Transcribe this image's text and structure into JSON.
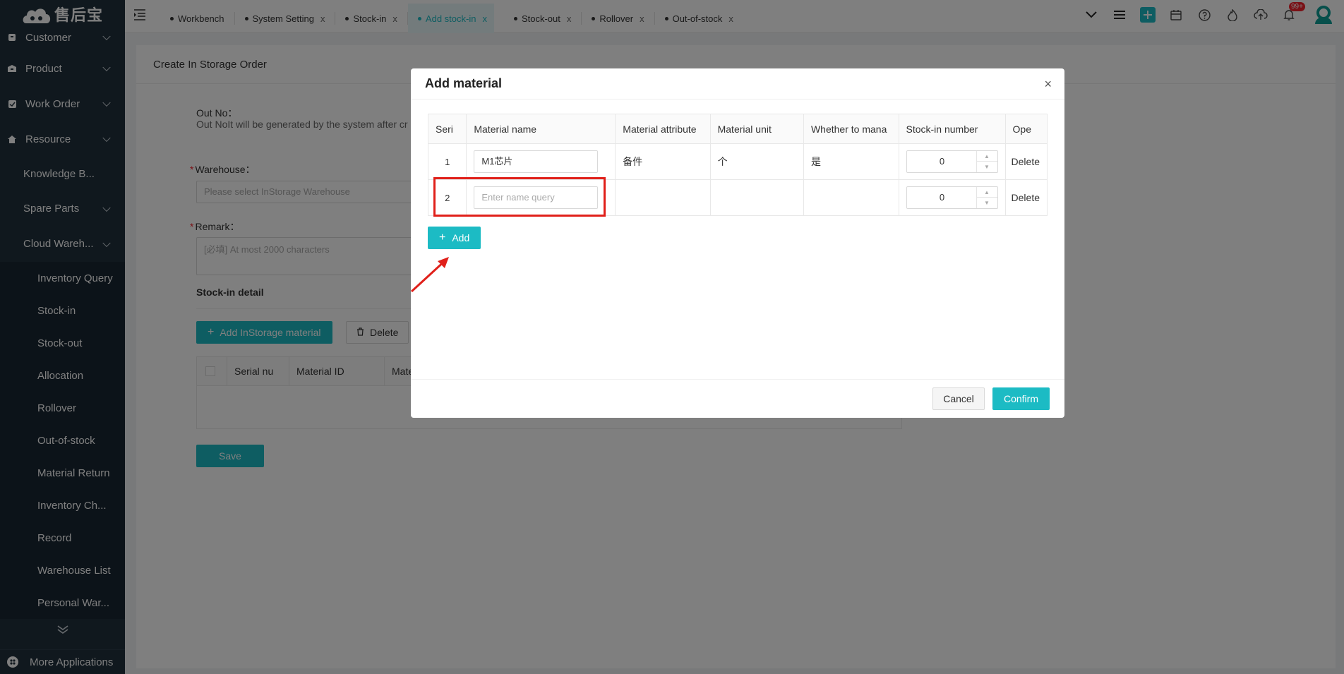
{
  "brand": {
    "name": "售后宝"
  },
  "sidebar": {
    "items": [
      {
        "label": "Customer",
        "icon": "customer-icon"
      },
      {
        "label": "Product",
        "icon": "product-icon"
      },
      {
        "label": "Work Order",
        "icon": "work-order-icon"
      },
      {
        "label": "Resource",
        "icon": "home-icon"
      }
    ],
    "resource_children": [
      {
        "label": "Knowledge B..."
      },
      {
        "label": "Spare Parts"
      },
      {
        "label": "Cloud Wareh..."
      }
    ],
    "cloud_children": [
      {
        "label": "Inventory Query"
      },
      {
        "label": "Stock-in"
      },
      {
        "label": "Stock-out"
      },
      {
        "label": "Allocation"
      },
      {
        "label": "Rollover"
      },
      {
        "label": "Out-of-stock"
      },
      {
        "label": "Material Return"
      },
      {
        "label": "Inventory Ch..."
      },
      {
        "label": "Record"
      },
      {
        "label": "Warehouse List"
      },
      {
        "label": "Personal War..."
      }
    ],
    "more_apps": "More Applications"
  },
  "tabs": [
    {
      "label": "Workbench"
    },
    {
      "label": "System Setting"
    },
    {
      "label": "Stock-in"
    },
    {
      "label": "Add stock-in"
    },
    {
      "label": "Stock-out"
    },
    {
      "label": "Rollover"
    },
    {
      "label": "Out-of-stock"
    }
  ],
  "tab_close": "x",
  "notifications": {
    "count": "99+"
  },
  "page": {
    "title": "Create In Storage Order",
    "out_no_label": "Out No：",
    "out_no_hint": "Out NoIt will be generated by the system after cr",
    "warehouse_label": "Warehouse：",
    "warehouse_placeholder": "Please select InStorage Warehouse",
    "remark_label": "Remark：",
    "remark_placeholder": "[必填] At most 2000 characters",
    "detail_title": "Stock-in detail",
    "add_material_btn": "Add InStorage material",
    "delete_btn": "Delete",
    "detail_columns": [
      "Serial nu",
      "Material ID",
      "Mate"
    ],
    "save_btn": "Save"
  },
  "modal": {
    "title": "Add material",
    "close": "×",
    "columns": [
      "Seri",
      "Material name",
      "Material attribute",
      "Material unit",
      "Whether to mana",
      "Stock-in number",
      "Ope"
    ],
    "rows": [
      {
        "serial": "1",
        "name": "M1芯片",
        "attribute": "备件",
        "unit": "个",
        "managed": "是",
        "qty": "0",
        "op": "Delete"
      },
      {
        "serial": "2",
        "name": "",
        "name_placeholder": "Enter name query",
        "attribute": "",
        "unit": "",
        "managed": "",
        "qty": "0",
        "op": "Delete"
      }
    ],
    "add_btn": "Add",
    "cancel_btn": "Cancel",
    "confirm_btn": "Confirm"
  },
  "colors": {
    "accent": "#1cbbc4",
    "sidebar": "#20303d",
    "danger": "#f5222d",
    "annotation": "#e0201a"
  }
}
